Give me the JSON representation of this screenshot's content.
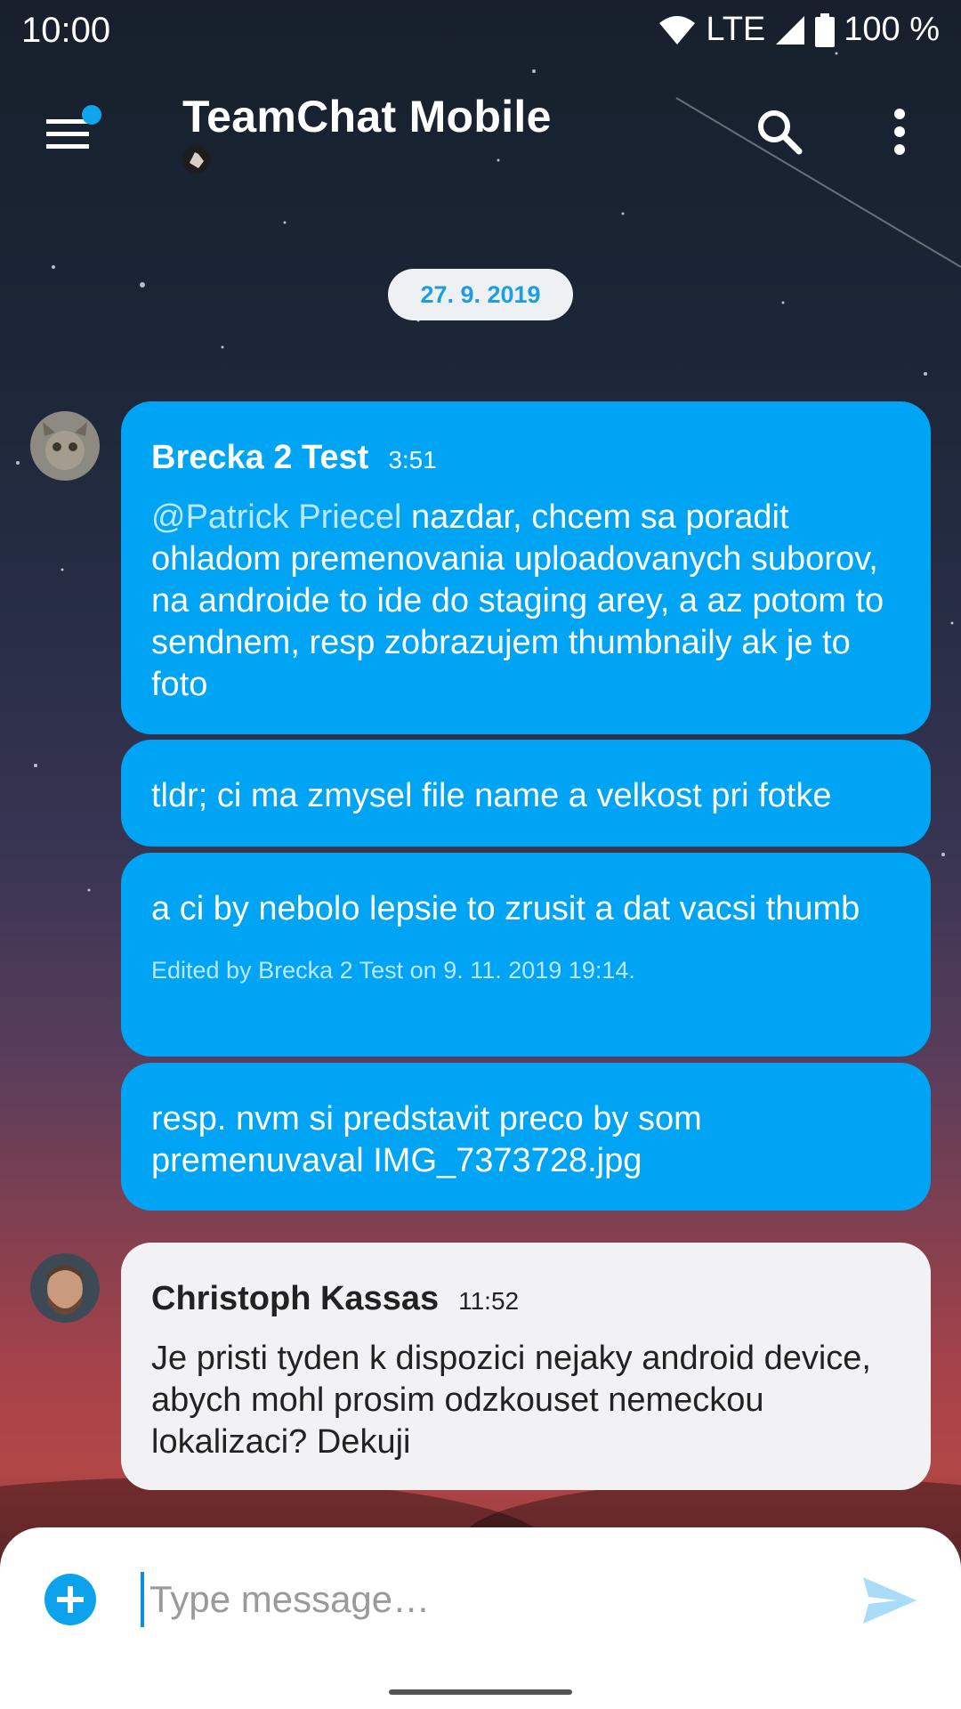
{
  "status_bar": {
    "time": "10:00",
    "network": "LTE",
    "battery": "100 %"
  },
  "app_bar": {
    "title": "TeamChat Mobile",
    "has_unread_indicator": true,
    "accent_color": "#0ea5ec"
  },
  "chat": {
    "date_separator": "27. 9. 2019",
    "groups": [
      {
        "author": "Brecka 2 Test",
        "time": "3:51",
        "messages": [
          {
            "mention": "@Patrick Priecel",
            "text": " nazdar, chcem sa poradit ohladom premenovania uploadovanych suborov, na androide to ide do staging arey, a az potom to sendnem, resp zobrazujem thumbnaily ak je to foto"
          },
          {
            "text": "tldr; ci ma zmysel file name a velkost pri fotke"
          },
          {
            "text": "a ci by nebolo lepsie to zrusit a dat vacsi thumb",
            "edited_note": "Edited by Brecka 2 Test on 9. 11. 2019 19:14."
          },
          {
            "text": "resp. nvm si predstavit preco by som premenuvaval IMG_7373728.jpg"
          }
        ]
      },
      {
        "author": "Christoph Kassas",
        "time": "11:52",
        "messages": [
          {
            "text": "Je pristi tyden k dispozici nejaky android device, abych mohl prosim odzkouset nemeckou lokalizaci? Dekuji"
          }
        ]
      }
    ]
  },
  "composer": {
    "placeholder": "Type message…"
  },
  "icons": {
    "menu": "menu-icon",
    "search": "search-icon",
    "more": "more-vert-icon",
    "add": "add-circle-icon",
    "send": "send-icon"
  },
  "colors": {
    "own_bubble": "#00a4f4",
    "other_bubble": "#f2f2f4",
    "date_text": "#1e9ee0"
  }
}
